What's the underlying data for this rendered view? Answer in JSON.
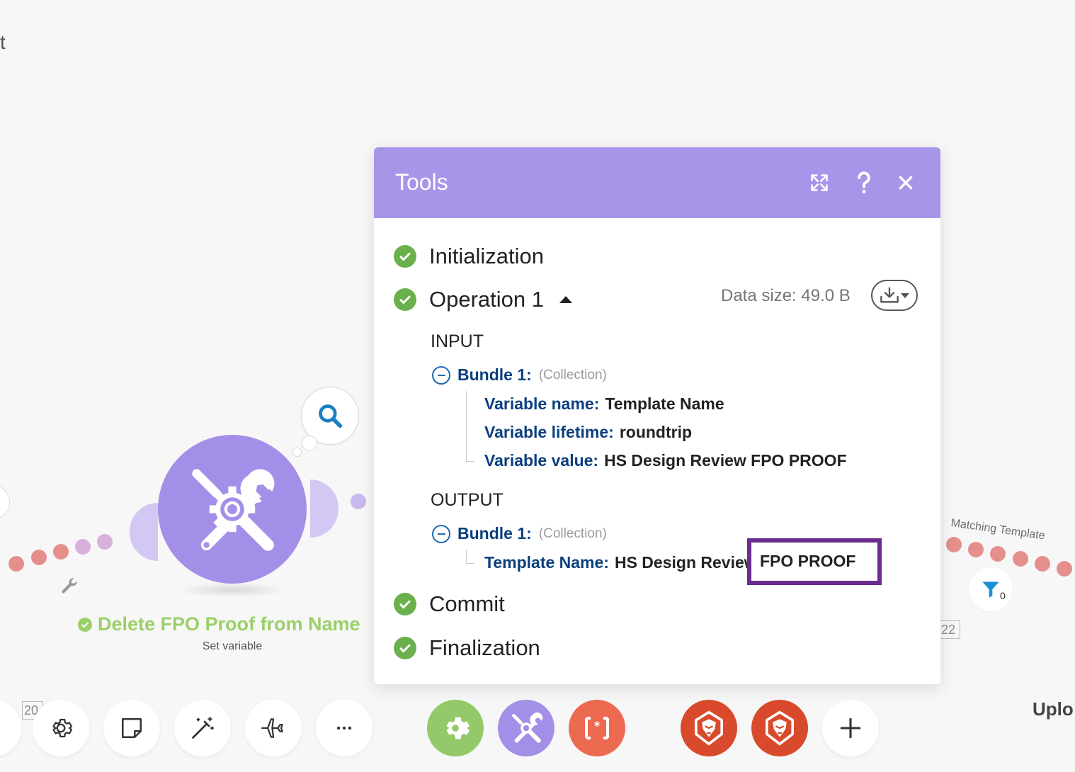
{
  "canvas": {
    "corner_text": "t",
    "node": {
      "title": "Delete FPO Proof from Name",
      "subtitle": "Set variable",
      "id_left": "20",
      "id_right": "22"
    },
    "right_label": "Matching Template",
    "filter_count": "0",
    "upload_text": "Uplo"
  },
  "modal": {
    "title": "Tools",
    "steps": {
      "initialization": "Initialization",
      "operation": "Operation 1",
      "commit": "Commit",
      "finalization": "Finalization"
    },
    "data_size": "Data size: 49.0 B",
    "input": {
      "heading": "INPUT",
      "bundle_label": "Bundle 1:",
      "bundle_type": "(Collection)",
      "rows": [
        {
          "key": "Variable name:",
          "value": "Template Name"
        },
        {
          "key": "Variable lifetime:",
          "value": "roundtrip"
        },
        {
          "key": "Variable value:",
          "value": "HS Design Review FPO PROOF"
        }
      ]
    },
    "output": {
      "heading": "OUTPUT",
      "bundle_label": "Bundle 1:",
      "bundle_type": "(Collection)",
      "rows": [
        {
          "key": "Template Name:",
          "value": "HS Design Review",
          "highlight": "FPO PROOF"
        }
      ]
    }
  },
  "toolbar": {
    "buttons": [
      "settings-icon",
      "note-icon",
      "magic-wand-icon",
      "airplane-icon",
      "more-icon"
    ],
    "apps": [
      "tools-settings-app",
      "tools-app",
      "json-app",
      "brave-app",
      "brave-app",
      "add-icon"
    ]
  },
  "colors": {
    "modal_header": "#a795ea",
    "node": "#a48fe8",
    "success": "#6ab04c",
    "node_title": "#9bd069",
    "highlight_border": "#6b2c8f",
    "brave": "#d84a2b",
    "json_app": "#ec6a50",
    "tools_app_green": "#94c96a"
  }
}
